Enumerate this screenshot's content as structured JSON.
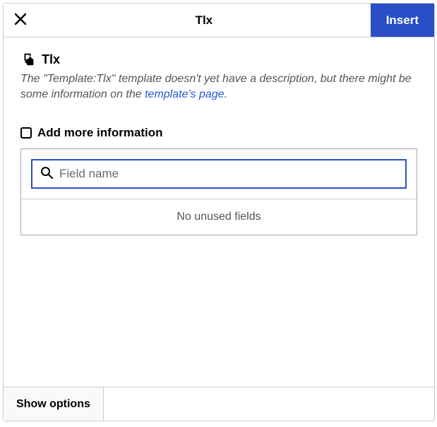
{
  "header": {
    "title": "Tlx",
    "insert_label": "Insert"
  },
  "template": {
    "name": "Tlx",
    "description_prefix": "The \"Template:Tlx\" template doesn't yet have a description, but there might be some information on the ",
    "description_link_text": "template's page",
    "description_suffix": "."
  },
  "add_info": {
    "heading": "Add more information",
    "search_placeholder": "Field name",
    "no_fields_text": "No unused fields"
  },
  "footer": {
    "show_options_label": "Show options"
  }
}
